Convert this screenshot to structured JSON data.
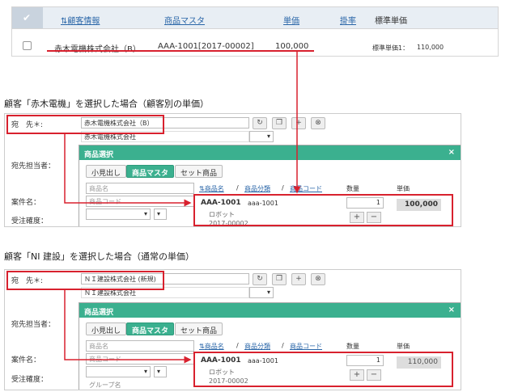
{
  "top": {
    "headers": [
      "顧客情報",
      "商品マスタ",
      "単価",
      "掛率",
      "標準単価"
    ],
    "row": {
      "customer": "赤木電機株式会社（B）",
      "product": "AAA-1001[2017-00002]",
      "price": "100,000",
      "std_label": "標準単価1：",
      "std_value": "110,000"
    }
  },
  "captions": [
    "顧客「赤木電機」を選択した場合（顧客別の単価）",
    "顧客「NI 建設」を選択した場合（通常の単価）"
  ],
  "panels": [
    {
      "dest_label": "宛　先＊:",
      "dest_value": "赤木電機株式会社（B）",
      "dest_sub": "赤木電機株式会社",
      "contact_label": "宛先担当者：",
      "case_label": "案件名：",
      "order_label": "受注確度：",
      "modal_title": "商品選択",
      "tabs": [
        "小見出し",
        "商品マスタ",
        "セット商品"
      ],
      "search_ph1": "商品名",
      "search_ph2": "商品コード",
      "cols": [
        "商品名",
        "商品分類",
        "商品コード",
        "数量",
        "単価"
      ],
      "item_code": "AAA-1001",
      "item_sub": "aaa-1001",
      "item_name": "ロボット",
      "item_no": "2017-00002",
      "qty": "1",
      "price": "100,000"
    },
    {
      "dest_label": "宛　先＊:",
      "dest_value": "ＮＩ建設株式会社 (新規)",
      "dest_sub": "ＮＩ建設株式会社",
      "contact_label": "宛先担当者：",
      "case_label": "案件名：",
      "order_label": "受注確度：",
      "modal_title": "商品選択",
      "tabs": [
        "小見出し",
        "商品マスタ",
        "セット商品"
      ],
      "search_ph1": "商品名",
      "search_ph2": "商品コード",
      "cols": [
        "商品名",
        "商品分類",
        "商品コード",
        "数量",
        "単価"
      ],
      "item_code": "AAA-1001",
      "item_sub": "aaa-1001",
      "item_name": "ロボット",
      "item_no": "2017-00002",
      "qty": "1",
      "price": "110,000",
      "dropdown_hint": "グループ名"
    }
  ],
  "colors": {
    "accent": "#3bb08f",
    "highlight": "#d8212e",
    "link": "#2a66a8"
  }
}
